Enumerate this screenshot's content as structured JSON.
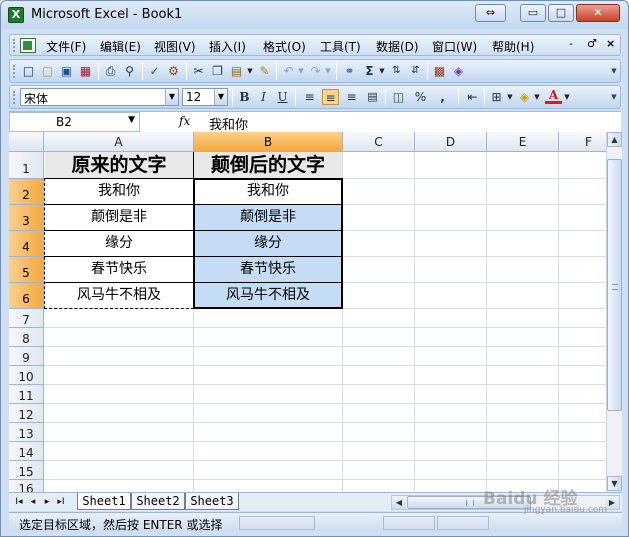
{
  "window": {
    "title": "Microsoft Excel - Book1",
    "controls": [
      "⇔",
      "▭",
      "□",
      "✕"
    ]
  },
  "menu": {
    "items": [
      "文件(F)",
      "编辑(E)",
      "视图(V)",
      "插入(I)",
      "格式(O)",
      "工具(T)",
      "数据(D)",
      "窗口(W)",
      "帮助(H)"
    ],
    "doc_controls": [
      "-",
      "♂",
      "×"
    ]
  },
  "formatting": {
    "font_name": "宋体",
    "font_size": "12",
    "bold": "B",
    "italic": "I",
    "underline": "U",
    "percent": "%",
    "comma": ","
  },
  "formula_bar": {
    "name_box": "B2",
    "fx": "fx",
    "value": "我和你"
  },
  "sheet": {
    "columns": [
      "A",
      "B",
      "C",
      "D",
      "E",
      "F"
    ],
    "rows": [
      "1",
      "2",
      "3",
      "4",
      "5",
      "6",
      "7",
      "8",
      "9",
      "10",
      "11",
      "12",
      "13",
      "14",
      "15",
      "16"
    ],
    "header_row": [
      "原来的文字",
      "颠倒后的文字"
    ],
    "col_a": [
      "我和你",
      "颠倒是非",
      "缘分",
      "春节快乐",
      "风马牛不相及"
    ],
    "col_b": [
      "我和你",
      "颠倒是非",
      "缘分",
      "春节快乐",
      "风马牛不相及"
    ],
    "active_cell": "B2",
    "selected_column": "B",
    "selected_rows": [
      "2",
      "3",
      "4",
      "5",
      "6"
    ]
  },
  "tabs": {
    "nav": [
      "I◂",
      "◂",
      "▸",
      "▸I"
    ],
    "sheets": [
      "Sheet1",
      "Sheet2",
      "Sheet3"
    ],
    "active": "Sheet1"
  },
  "status": {
    "text": "选定目标区域，然后按 ENTER 或选择"
  },
  "watermark": {
    "text": "Baidu 经验",
    "sub": "jingyan.baidu.com"
  },
  "colors": {
    "selection_fill": "#c5dcf6",
    "header_highlight": "#f4a93e",
    "chrome": "#cfe0f4"
  }
}
